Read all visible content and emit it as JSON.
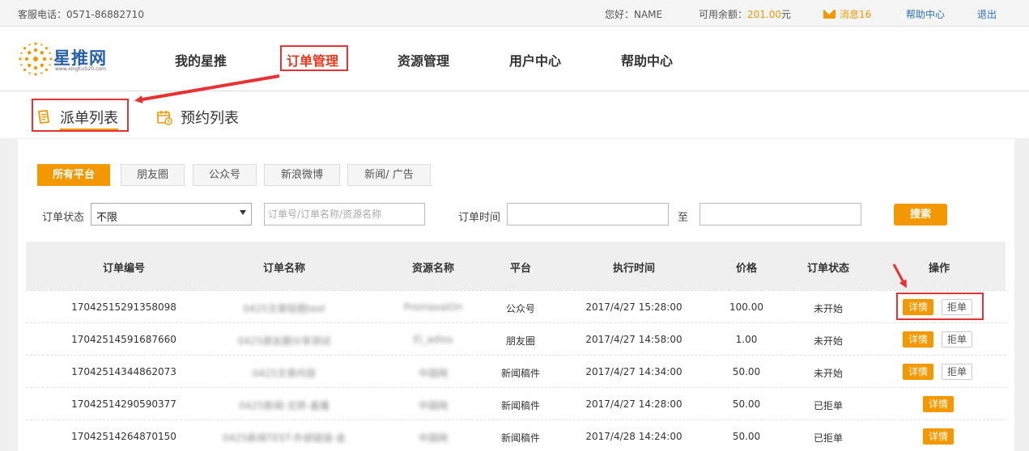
{
  "topbar": {
    "hotline": "客服电话：0571-86882710",
    "greeting": "您好：NAME",
    "balance_label": "可用余额：",
    "balance_value": "201.00",
    "balance_unit": "元",
    "messages_label": "消息",
    "messages_count": "16",
    "help": "帮助中心",
    "logout": "退出"
  },
  "logo": {
    "brand": "星推网",
    "url": "www.xingtui520.com"
  },
  "nav": {
    "items": [
      {
        "label": "我的星推"
      },
      {
        "label": "订单管理"
      },
      {
        "label": "资源管理"
      },
      {
        "label": "用户中心"
      },
      {
        "label": "帮助中心"
      }
    ]
  },
  "tabs": [
    {
      "label": "派单列表",
      "icon": "order-list-icon"
    },
    {
      "label": "预约列表",
      "icon": "calendar-icon"
    }
  ],
  "platforms": [
    "所有平台",
    "朋友圈",
    "公众号",
    "新浪微博",
    "新闻/ 广告"
  ],
  "filters": {
    "status_label": "订单状态",
    "status_value": "不限",
    "keyword_placeholder": "订单号/订单名称/资源名称",
    "time_label": "订单时间",
    "to_label": "至",
    "search_label": "搜索"
  },
  "table": {
    "headers": [
      "订单编号",
      "订单名称",
      "资源名称",
      "平台",
      "执行时间",
      "价格",
      "订单状态",
      "操作"
    ],
    "detail_label": "详情",
    "reject_label": "拒单",
    "rows": [
      {
        "id": "17042515291358098",
        "name": "0425文章轻图test",
        "resource": "PromaxaiOn",
        "platform": "公众号",
        "time": "2017/4/27 15:28:00",
        "price": "100.00",
        "status": "未开始",
        "can_reject": true
      },
      {
        "id": "17042514591687660",
        "name": "0425朋友圈分享测试",
        "resource": "El_adios",
        "platform": "朋友圈",
        "time": "2017/4/27 14:58:00",
        "price": "1.00",
        "status": "未开始",
        "can_reject": true
      },
      {
        "id": "17042514344862073",
        "name": "0425文章内容",
        "resource": "中国网",
        "platform": "新闻稿件",
        "time": "2017/4/27 14:34:00",
        "price": "50.00",
        "status": "未开始",
        "can_reject": true
      },
      {
        "id": "17042514290590377",
        "name": "0425新闻-文转-直播",
        "resource": "中国网",
        "platform": "新闻稿件",
        "time": "2017/4/27 14:28:00",
        "price": "50.00",
        "status": "已拒单",
        "can_reject": false
      },
      {
        "id": "17042514264870150",
        "name": "0425新闻TEST-外部链接-金",
        "resource": "中国网",
        "platform": "新闻稿件",
        "time": "2017/4/28 14:24:00",
        "price": "50.00",
        "status": "已拒单",
        "can_reject": false
      }
    ]
  },
  "colors": {
    "accent": "#f39800",
    "highlight": "#e63232",
    "link": "#2d6fc0"
  }
}
